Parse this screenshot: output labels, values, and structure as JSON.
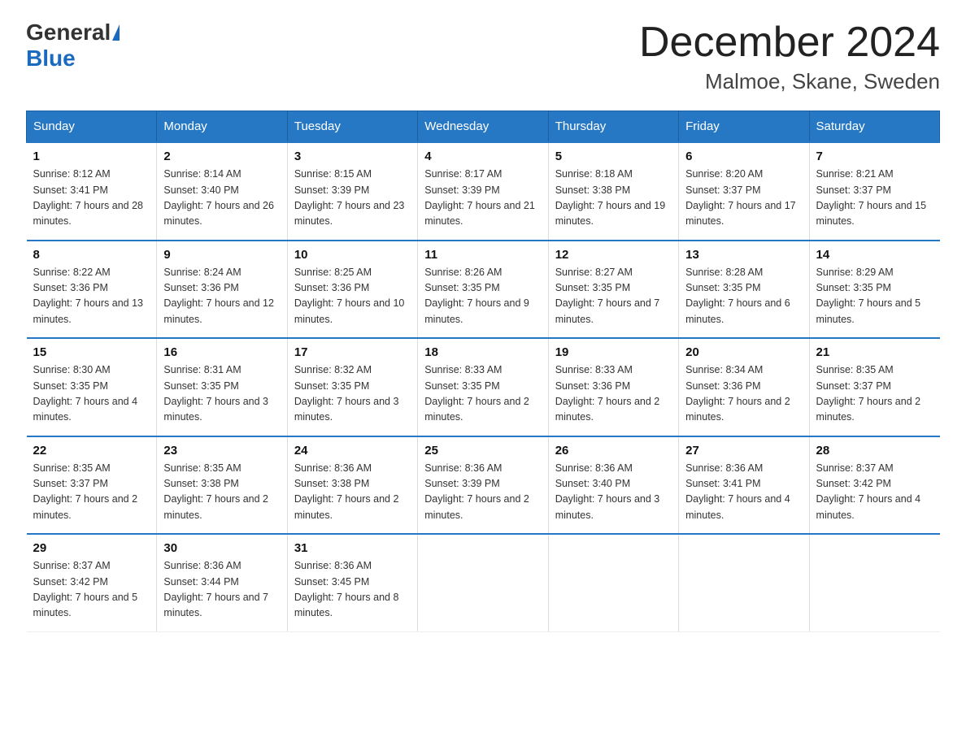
{
  "logo": {
    "general": "General",
    "triangle": "▶",
    "blue": "Blue"
  },
  "title": "December 2024",
  "location": "Malmoe, Skane, Sweden",
  "headers": [
    "Sunday",
    "Monday",
    "Tuesday",
    "Wednesday",
    "Thursday",
    "Friday",
    "Saturday"
  ],
  "weeks": [
    [
      {
        "day": "1",
        "sunrise": "8:12 AM",
        "sunset": "3:41 PM",
        "daylight": "7 hours and 28 minutes."
      },
      {
        "day": "2",
        "sunrise": "8:14 AM",
        "sunset": "3:40 PM",
        "daylight": "7 hours and 26 minutes."
      },
      {
        "day": "3",
        "sunrise": "8:15 AM",
        "sunset": "3:39 PM",
        "daylight": "7 hours and 23 minutes."
      },
      {
        "day": "4",
        "sunrise": "8:17 AM",
        "sunset": "3:39 PM",
        "daylight": "7 hours and 21 minutes."
      },
      {
        "day": "5",
        "sunrise": "8:18 AM",
        "sunset": "3:38 PM",
        "daylight": "7 hours and 19 minutes."
      },
      {
        "day": "6",
        "sunrise": "8:20 AM",
        "sunset": "3:37 PM",
        "daylight": "7 hours and 17 minutes."
      },
      {
        "day": "7",
        "sunrise": "8:21 AM",
        "sunset": "3:37 PM",
        "daylight": "7 hours and 15 minutes."
      }
    ],
    [
      {
        "day": "8",
        "sunrise": "8:22 AM",
        "sunset": "3:36 PM",
        "daylight": "7 hours and 13 minutes."
      },
      {
        "day": "9",
        "sunrise": "8:24 AM",
        "sunset": "3:36 PM",
        "daylight": "7 hours and 12 minutes."
      },
      {
        "day": "10",
        "sunrise": "8:25 AM",
        "sunset": "3:36 PM",
        "daylight": "7 hours and 10 minutes."
      },
      {
        "day": "11",
        "sunrise": "8:26 AM",
        "sunset": "3:35 PM",
        "daylight": "7 hours and 9 minutes."
      },
      {
        "day": "12",
        "sunrise": "8:27 AM",
        "sunset": "3:35 PM",
        "daylight": "7 hours and 7 minutes."
      },
      {
        "day": "13",
        "sunrise": "8:28 AM",
        "sunset": "3:35 PM",
        "daylight": "7 hours and 6 minutes."
      },
      {
        "day": "14",
        "sunrise": "8:29 AM",
        "sunset": "3:35 PM",
        "daylight": "7 hours and 5 minutes."
      }
    ],
    [
      {
        "day": "15",
        "sunrise": "8:30 AM",
        "sunset": "3:35 PM",
        "daylight": "7 hours and 4 minutes."
      },
      {
        "day": "16",
        "sunrise": "8:31 AM",
        "sunset": "3:35 PM",
        "daylight": "7 hours and 3 minutes."
      },
      {
        "day": "17",
        "sunrise": "8:32 AM",
        "sunset": "3:35 PM",
        "daylight": "7 hours and 3 minutes."
      },
      {
        "day": "18",
        "sunrise": "8:33 AM",
        "sunset": "3:35 PM",
        "daylight": "7 hours and 2 minutes."
      },
      {
        "day": "19",
        "sunrise": "8:33 AM",
        "sunset": "3:36 PM",
        "daylight": "7 hours and 2 minutes."
      },
      {
        "day": "20",
        "sunrise": "8:34 AM",
        "sunset": "3:36 PM",
        "daylight": "7 hours and 2 minutes."
      },
      {
        "day": "21",
        "sunrise": "8:35 AM",
        "sunset": "3:37 PM",
        "daylight": "7 hours and 2 minutes."
      }
    ],
    [
      {
        "day": "22",
        "sunrise": "8:35 AM",
        "sunset": "3:37 PM",
        "daylight": "7 hours and 2 minutes."
      },
      {
        "day": "23",
        "sunrise": "8:35 AM",
        "sunset": "3:38 PM",
        "daylight": "7 hours and 2 minutes."
      },
      {
        "day": "24",
        "sunrise": "8:36 AM",
        "sunset": "3:38 PM",
        "daylight": "7 hours and 2 minutes."
      },
      {
        "day": "25",
        "sunrise": "8:36 AM",
        "sunset": "3:39 PM",
        "daylight": "7 hours and 2 minutes."
      },
      {
        "day": "26",
        "sunrise": "8:36 AM",
        "sunset": "3:40 PM",
        "daylight": "7 hours and 3 minutes."
      },
      {
        "day": "27",
        "sunrise": "8:36 AM",
        "sunset": "3:41 PM",
        "daylight": "7 hours and 4 minutes."
      },
      {
        "day": "28",
        "sunrise": "8:37 AM",
        "sunset": "3:42 PM",
        "daylight": "7 hours and 4 minutes."
      }
    ],
    [
      {
        "day": "29",
        "sunrise": "8:37 AM",
        "sunset": "3:42 PM",
        "daylight": "7 hours and 5 minutes."
      },
      {
        "day": "30",
        "sunrise": "8:36 AM",
        "sunset": "3:44 PM",
        "daylight": "7 hours and 7 minutes."
      },
      {
        "day": "31",
        "sunrise": "8:36 AM",
        "sunset": "3:45 PM",
        "daylight": "7 hours and 8 minutes."
      },
      null,
      null,
      null,
      null
    ]
  ]
}
